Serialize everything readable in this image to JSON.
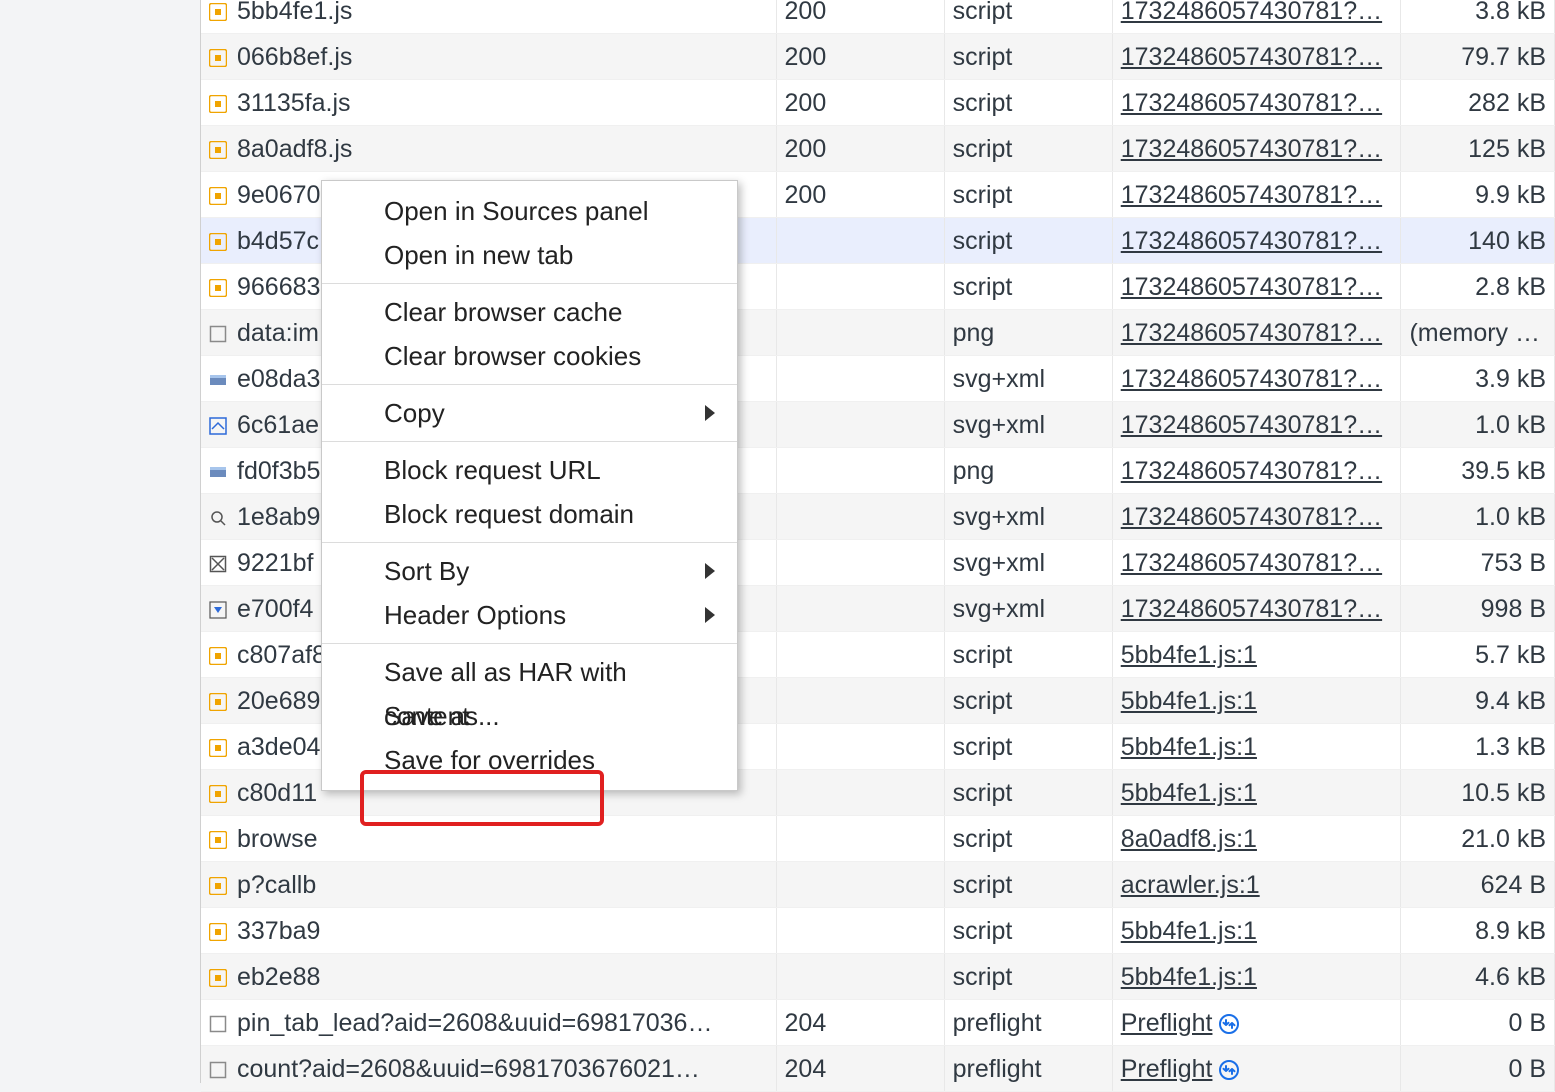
{
  "rows": [
    {
      "icon": "js",
      "name": "5bb4fe1.js",
      "status": "200",
      "type": "script",
      "initiator": "1732486057430781?…",
      "size": "3.8 kB"
    },
    {
      "icon": "js",
      "name": "066b8ef.js",
      "status": "200",
      "type": "script",
      "initiator": "1732486057430781?…",
      "size": "79.7 kB"
    },
    {
      "icon": "js",
      "name": "31135fa.js",
      "status": "200",
      "type": "script",
      "initiator": "1732486057430781?…",
      "size": "282 kB"
    },
    {
      "icon": "js",
      "name": "8a0adf8.js",
      "status": "200",
      "type": "script",
      "initiator": "1732486057430781?…",
      "size": "125 kB"
    },
    {
      "icon": "js",
      "name": "9e0670a.js",
      "status": "200",
      "type": "script",
      "initiator": "1732486057430781?…",
      "size": "9.9 kB"
    },
    {
      "icon": "js",
      "name": "b4d57c",
      "status": "",
      "type": "script",
      "initiator": "1732486057430781?…",
      "size": "140 kB",
      "selected": true
    },
    {
      "icon": "js",
      "name": "966683",
      "status": "",
      "type": "script",
      "initiator": "1732486057430781?…",
      "size": "2.8 kB"
    },
    {
      "icon": "generic",
      "name": "data:im",
      "status": "",
      "type": "png",
      "initiator": "1732486057430781?…",
      "size": "(memory c…"
    },
    {
      "icon": "img",
      "name": "e08da3",
      "status": "",
      "type": "svg+xml",
      "initiator": "1732486057430781?…",
      "size": "3.9 kB"
    },
    {
      "icon": "svg",
      "name": "6c61ae",
      "status": "",
      "type": "svg+xml",
      "initiator": "1732486057430781?…",
      "size": "1.0 kB"
    },
    {
      "icon": "img",
      "name": "fd0f3b5",
      "status": "",
      "type": "png",
      "initiator": "1732486057430781?…",
      "size": "39.5 kB"
    },
    {
      "icon": "search",
      "name": "1e8ab9",
      "status": "",
      "type": "svg+xml",
      "initiator": "1732486057430781?…",
      "size": "1.0 kB"
    },
    {
      "icon": "broken",
      "name": "9221bf",
      "status": "",
      "type": "svg+xml",
      "initiator": "1732486057430781?…",
      "size": "753 B"
    },
    {
      "icon": "arrow",
      "name": "e700f4",
      "status": "",
      "type": "svg+xml",
      "initiator": "1732486057430781?…",
      "size": "998 B"
    },
    {
      "icon": "js",
      "name": "c807af8",
      "status": "",
      "type": "script",
      "initiator": "5bb4fe1.js:1",
      "size": "5.7 kB"
    },
    {
      "icon": "js",
      "name": "20e689",
      "status": "",
      "type": "script",
      "initiator": "5bb4fe1.js:1",
      "size": "9.4 kB"
    },
    {
      "icon": "js",
      "name": "a3de04",
      "status": "",
      "type": "script",
      "initiator": "5bb4fe1.js:1",
      "size": "1.3 kB"
    },
    {
      "icon": "js",
      "name": "c80d11",
      "status": "",
      "type": "script",
      "initiator": "5bb4fe1.js:1",
      "size": "10.5 kB"
    },
    {
      "icon": "js",
      "name": "browse",
      "status": "",
      "type": "script",
      "initiator": "8a0adf8.js:1",
      "size": "21.0 kB"
    },
    {
      "icon": "js",
      "name": "p?callb",
      "status": "",
      "type": "script",
      "initiator": "acrawler.js:1",
      "size": "624 B"
    },
    {
      "icon": "js",
      "name": "337ba9",
      "status": "",
      "type": "script",
      "initiator": "5bb4fe1.js:1",
      "size": "8.9 kB"
    },
    {
      "icon": "js",
      "name": "eb2e88",
      "status": "",
      "type": "script",
      "initiator": "5bb4fe1.js:1",
      "size": "4.6 kB"
    },
    {
      "icon": "generic",
      "name": "pin_tab_lead?aid=2608&uuid=69817036…",
      "status": "204",
      "type": "preflight",
      "initiator": "Preflight",
      "size": "0 B",
      "preflight": true
    },
    {
      "icon": "generic",
      "name": "count?aid=2608&uuid=6981703676021…",
      "status": "204",
      "type": "preflight",
      "initiator": "Preflight",
      "size": "0 B",
      "preflight": true
    }
  ],
  "menu": {
    "open_sources": "Open in Sources panel",
    "open_tab": "Open in new tab",
    "clear_cache": "Clear browser cache",
    "clear_cookies": "Clear browser cookies",
    "copy": "Copy",
    "block_url": "Block request URL",
    "block_domain": "Block request domain",
    "sort_by": "Sort By",
    "header_opts": "Header Options",
    "save_har": "Save all as HAR with content",
    "save_as": "Save as...",
    "save_overrides": "Save for overrides"
  }
}
